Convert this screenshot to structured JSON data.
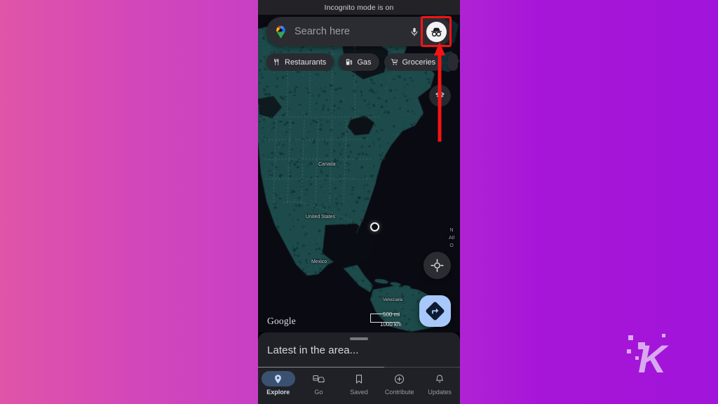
{
  "background": {
    "gradient_from": "#e055a8",
    "gradient_to": "#a114d9",
    "watermark_letter": "K"
  },
  "phone": {
    "incognito_banner": "Incognito mode is on",
    "search": {
      "placeholder": "Search here",
      "value": "",
      "mic_icon": "microphone-icon",
      "avatar_icon": "incognito-avatar-icon",
      "google_icon": "google-maps-pin-icon",
      "highlight_color": "#f21414"
    },
    "chips": [
      {
        "label": "Restaurants",
        "icon": "restaurant-fork-knife-icon"
      },
      {
        "label": "Gas",
        "icon": "gas-pump-icon"
      },
      {
        "label": "Groceries",
        "icon": "shopping-cart-icon"
      }
    ],
    "map": {
      "attribution": "Google",
      "labels": [
        {
          "id": "canada",
          "text": "Canada"
        },
        {
          "id": "united_states",
          "text": "United States"
        },
        {
          "id": "mexico",
          "text": "Mexico"
        },
        {
          "id": "venezuela",
          "text": "Venezuela"
        },
        {
          "id": "ocean",
          "text": "N\nAtl\nO"
        }
      ],
      "scale": {
        "miles": "500 mi",
        "kilometers": "1000 km"
      },
      "controls": [
        {
          "id": "layers",
          "icon": "map-layers-icon"
        },
        {
          "id": "locate",
          "icon": "my-location-crosshair-icon"
        },
        {
          "id": "directions",
          "icon": "directions-arrow-icon"
        }
      ],
      "land_color": "#1d4a4a",
      "water_color": "#0a0a12",
      "directions_fab_color": "#a8c7fa"
    },
    "sheet": {
      "title": "Latest in the area..."
    },
    "bottom_nav": [
      {
        "label": "Explore",
        "icon": "location-pin-icon",
        "active": true
      },
      {
        "label": "Go",
        "icon": "commute-car-bus-icon",
        "active": false
      },
      {
        "label": "Saved",
        "icon": "bookmark-icon",
        "active": false
      },
      {
        "label": "Contribute",
        "icon": "plus-circle-icon",
        "active": false
      },
      {
        "label": "Updates",
        "icon": "bell-icon",
        "active": false
      }
    ]
  },
  "annotation": {
    "arrow_color": "#f21414",
    "arrow_direction": "up",
    "target": "incognito-avatar-button"
  }
}
